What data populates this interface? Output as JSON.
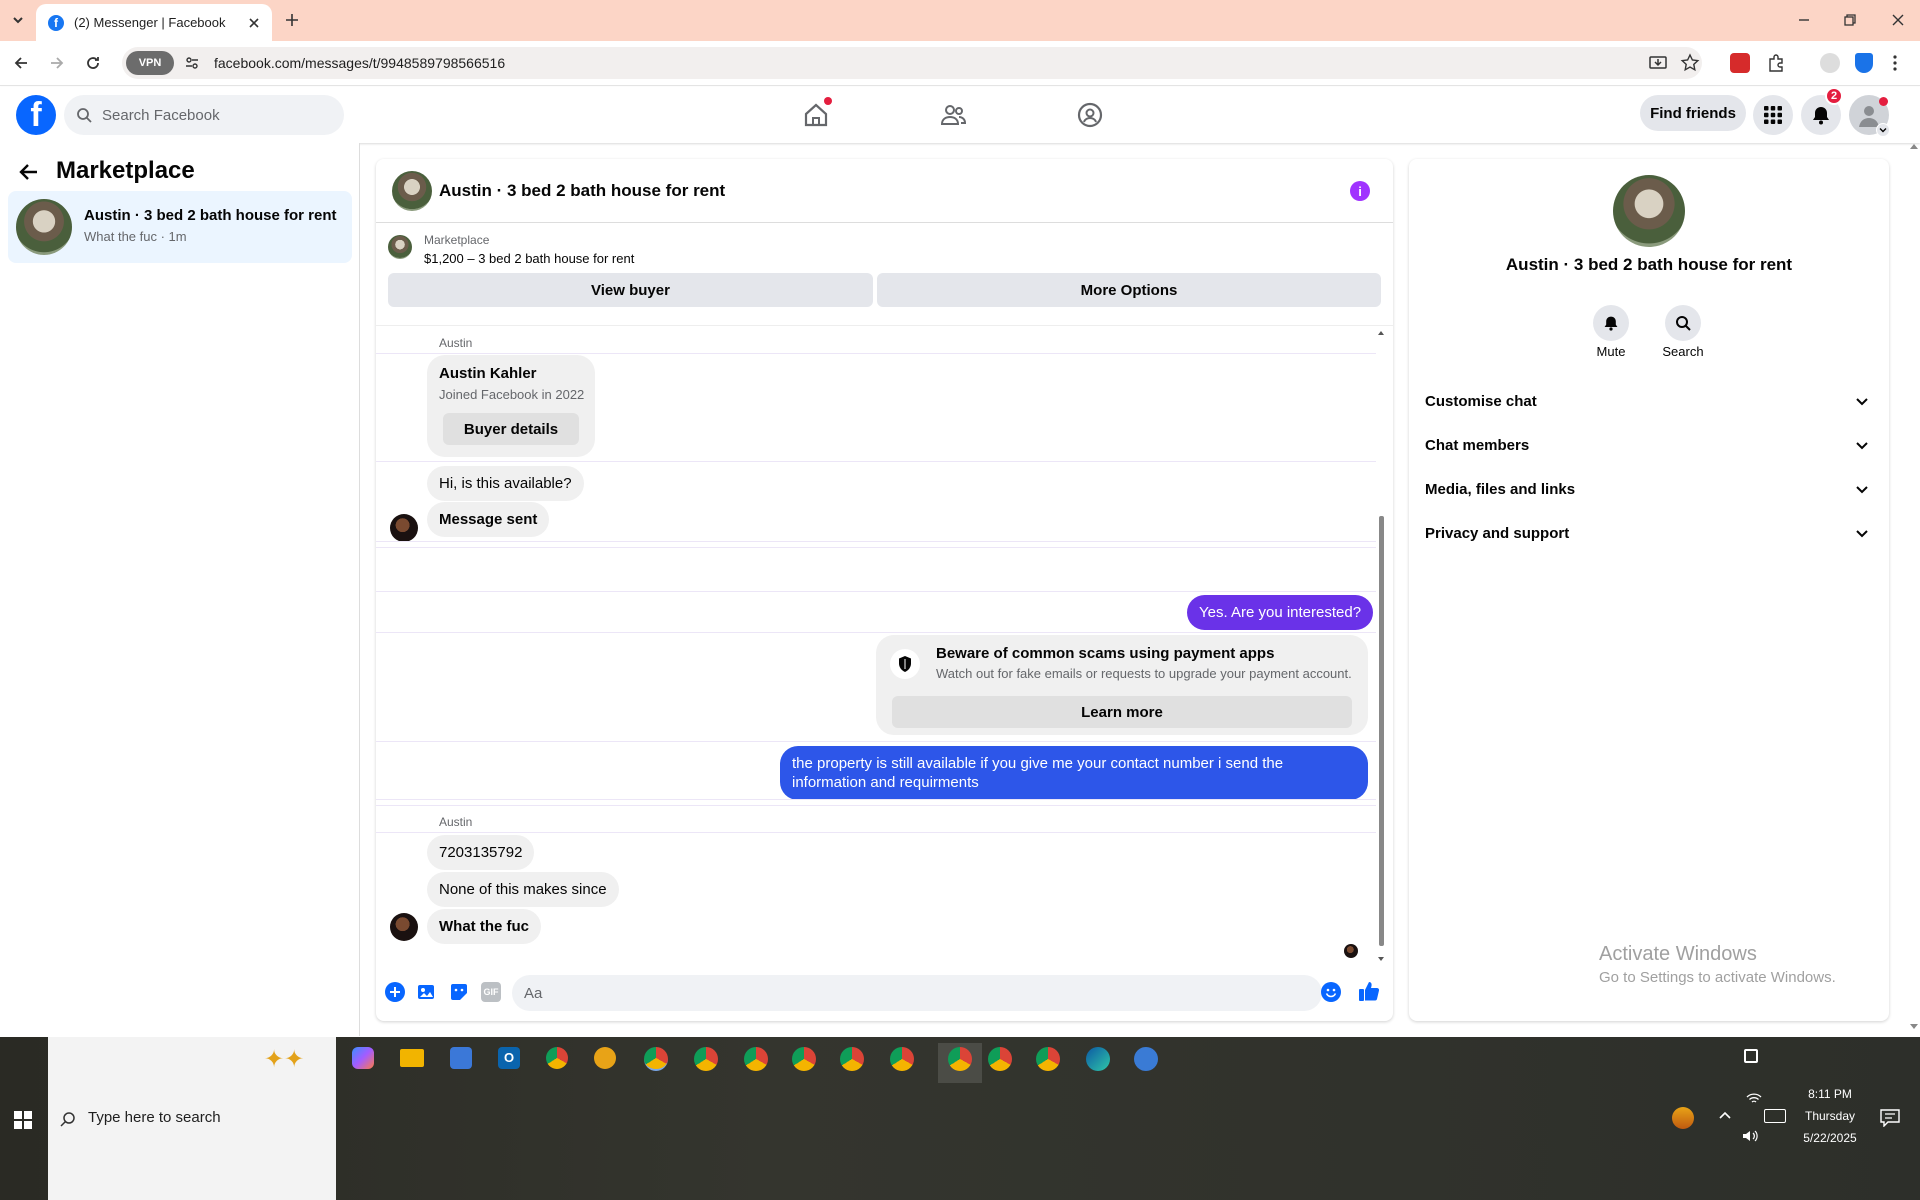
{
  "browser": {
    "tab_title": "(2) Messenger | Facebook",
    "url": "facebook.com/messages/t/9948589798566516",
    "vpn_label": "VPN"
  },
  "fb_header": {
    "search_placeholder": "Search Facebook",
    "find_friends_label": "Find friends",
    "notification_count": "2"
  },
  "sidebar": {
    "title": "Marketplace",
    "conversation": {
      "name": "Austin · 3 bed 2 bath house for rent",
      "preview": "What the fuc · 1m"
    }
  },
  "chat": {
    "title": "Austin · 3 bed 2 bath house for rent",
    "listing_label": "Marketplace",
    "listing_price_title": "$1,200 – 3 bed 2 bath house for rent",
    "view_buyer_label": "View buyer",
    "more_options_label": "More Options",
    "sender_name_1": "Austin",
    "buyer_card": {
      "name": "Austin Kahler",
      "joined": "Joined Facebook in 2022",
      "button": "Buyer details"
    },
    "msg_1": "Hi, is this available?",
    "msg_2": "Message sent",
    "my_msg_1": "Yes. Are you interested?",
    "scam_warning": {
      "title": "Beware of common scams using payment apps",
      "body": "Watch out for fake emails or requests to upgrade your payment account.",
      "button": "Learn more"
    },
    "my_msg_2": "the property is still available if you give me your contact number i send the information and requirments",
    "sender_name_2": "Austin",
    "msg_3": "7203135792",
    "msg_4": "None of this makes since",
    "msg_5": "What the fuc",
    "composer_placeholder": "Aa"
  },
  "info_panel": {
    "title": "Austin · 3 bed 2 bath house for rent",
    "mute_label": "Mute",
    "search_label": "Search",
    "sections": [
      "Customise chat",
      "Chat members",
      "Media, files and links",
      "Privacy and support"
    ]
  },
  "watermark": {
    "line1": "Activate Windows",
    "line2": "Go to Settings to activate Windows."
  },
  "taskbar": {
    "search_placeholder": "Type here to search",
    "time": "8:11 PM",
    "day": "Thursday",
    "date": "5/22/2025"
  },
  "colors": {
    "fb_blue": "#0866ff",
    "my_bubble_purple": "#6a32e8",
    "my_bubble_blue": "#2d56e9",
    "tab_strip": "#fcd5c6"
  }
}
